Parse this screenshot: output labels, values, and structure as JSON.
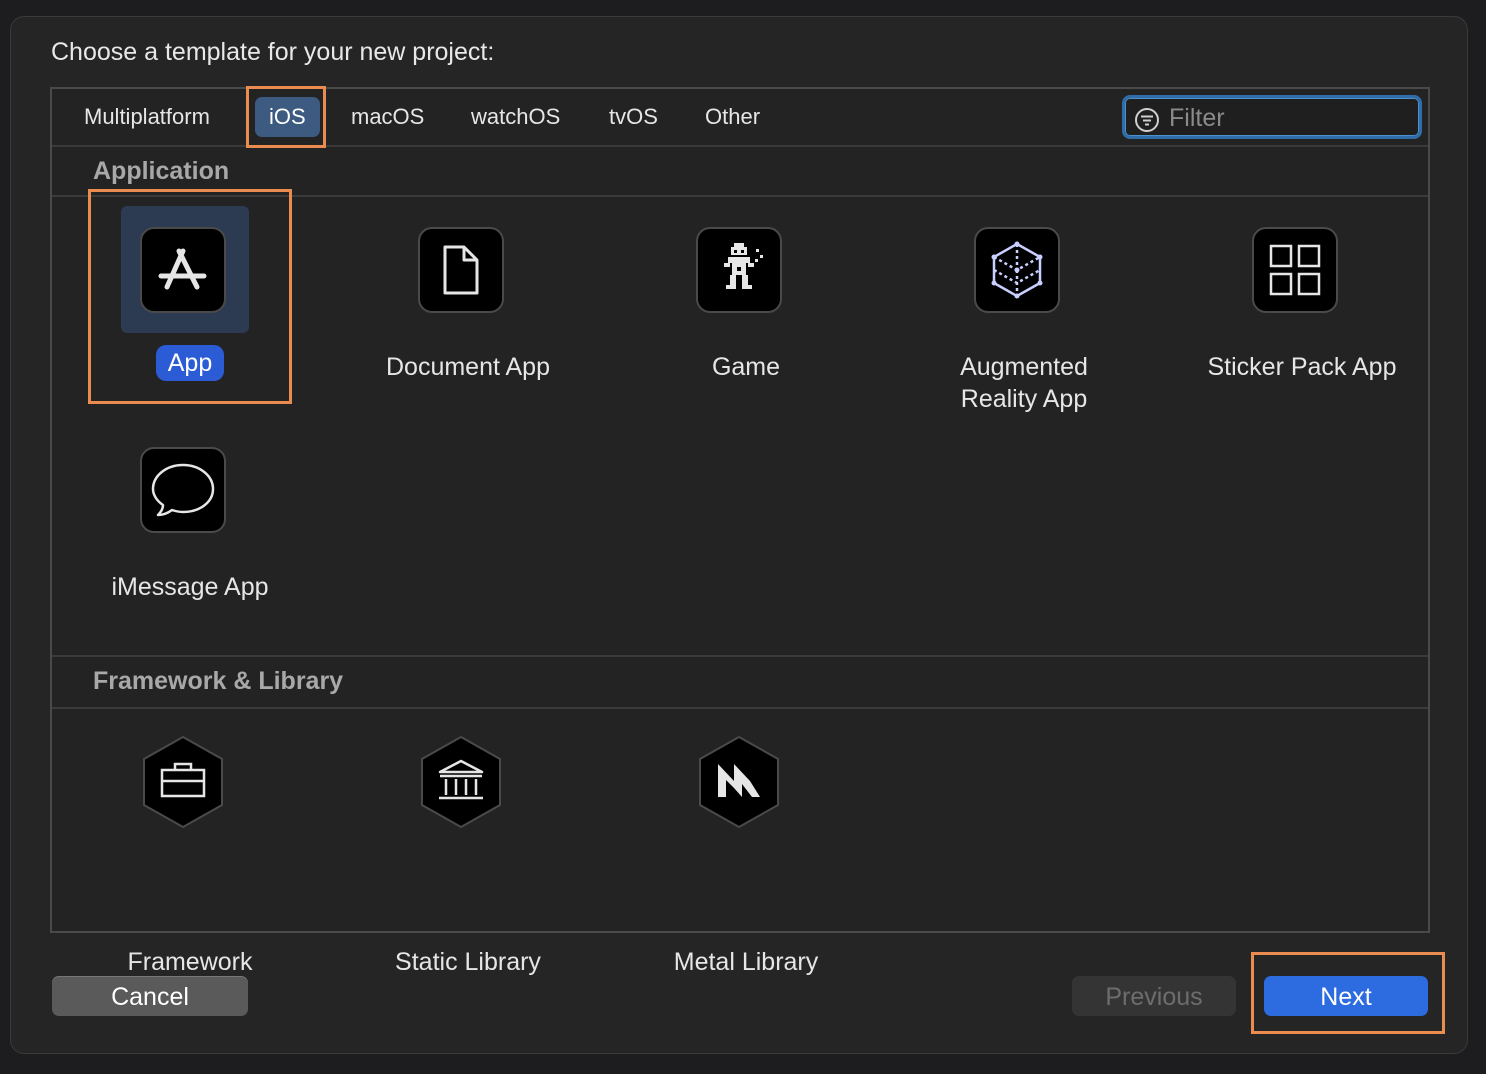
{
  "dialog": {
    "prompt": "Choose a template for your new project:"
  },
  "tabs": [
    {
      "label": "Multiplatform",
      "active": false
    },
    {
      "label": "iOS",
      "active": true
    },
    {
      "label": "macOS",
      "active": false
    },
    {
      "label": "watchOS",
      "active": false
    },
    {
      "label": "tvOS",
      "active": false
    },
    {
      "label": "Other",
      "active": false
    }
  ],
  "filter": {
    "placeholder": "Filter",
    "value": "",
    "icon": "filter-icon"
  },
  "sections": [
    {
      "title": "Application",
      "items": [
        {
          "label": "App",
          "icon": "app-store-icon",
          "selected": true
        },
        {
          "label": "Document App",
          "icon": "document-icon",
          "selected": false
        },
        {
          "label": "Game",
          "icon": "game-sprite-icon",
          "selected": false
        },
        {
          "label": "Augmented\nReality App",
          "icon": "ar-cube-icon",
          "selected": false
        },
        {
          "label": "Sticker Pack App",
          "icon": "sticker-grid-icon",
          "selected": false
        },
        {
          "label": "iMessage App",
          "icon": "message-bubble-icon",
          "selected": false
        }
      ]
    },
    {
      "title": "Framework & Library",
      "items": [
        {
          "label": "Framework",
          "icon": "toolbox-icon",
          "selected": false
        },
        {
          "label": "Static Library",
          "icon": "library-building-icon",
          "selected": false
        },
        {
          "label": "Metal Library",
          "icon": "metal-icon",
          "selected": false
        }
      ]
    }
  ],
  "buttons": {
    "cancel": "Cancel",
    "previous": "Previous",
    "next": "Next"
  },
  "colors": {
    "accent": "#2d6be0",
    "selected_tab": "#3d5a80",
    "highlight": "#ea8c50"
  }
}
